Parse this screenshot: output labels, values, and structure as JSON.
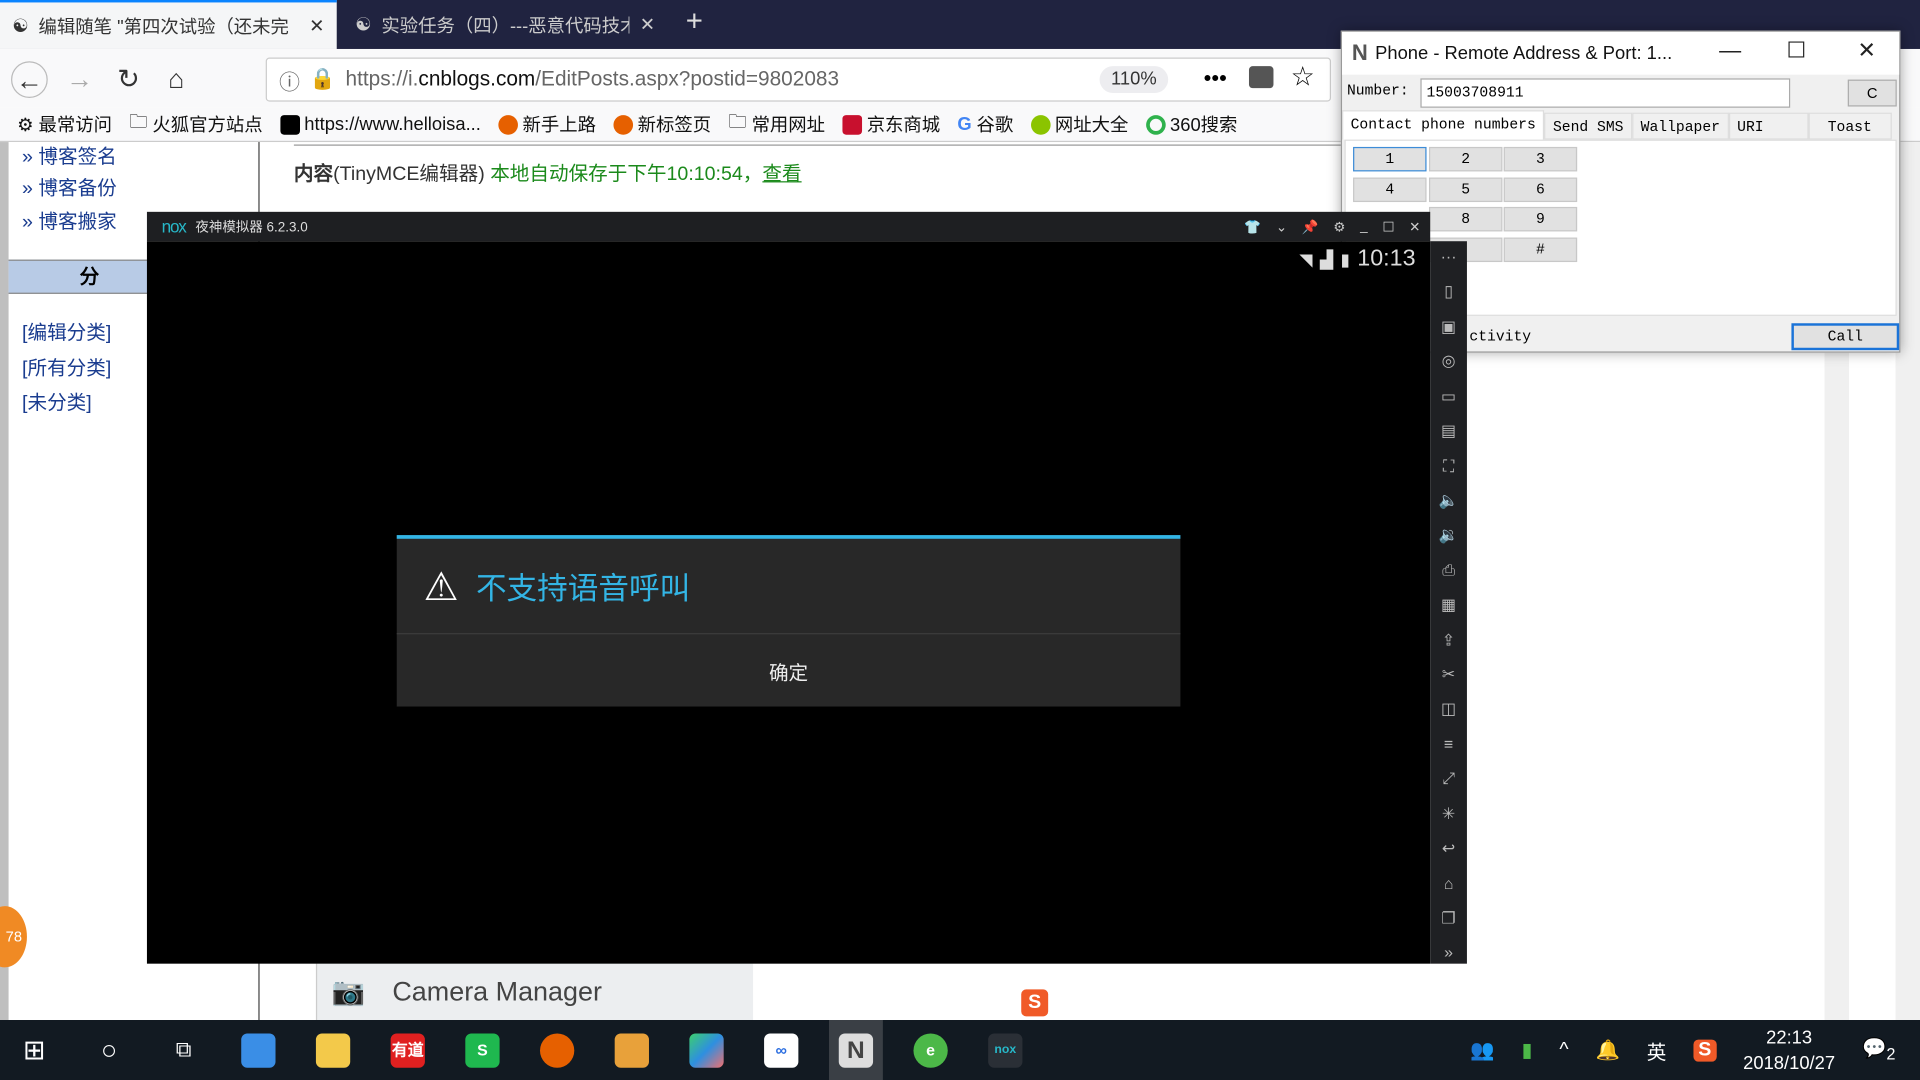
{
  "browser": {
    "tabs": [
      {
        "title": "编辑随笔 \"第四次试验（还未完",
        "active": true
      },
      {
        "title": "实验任务（四）---恶意代码技术",
        "active": false
      }
    ],
    "url_prefix": "https://i.",
    "url_domain": "cnblogs.com",
    "url_path": "/EditPosts.aspx?postid=9802083",
    "zoom": "110%",
    "bookmarks": [
      "最常访问",
      "火狐官方站点",
      "https://www.helloisa...",
      "新手上路",
      "新标签页",
      "常用网址",
      "京东商城",
      "谷歌",
      "网址大全",
      "360搜索"
    ]
  },
  "page": {
    "sidebar_links": [
      "» 博客签名",
      "» 博客备份",
      "» 博客搬家"
    ],
    "category_header": "分 类",
    "category_links": [
      "[编辑分类]",
      "[所有分类]",
      "[未分类]"
    ],
    "content_label": "内容",
    "content_editor": "(TinyMCE编辑器)",
    "autosave": "本地自动保存于下午10:10:54，",
    "view_link": "查看",
    "camera_manager": "Camera Manager",
    "badge": "78"
  },
  "nox": {
    "logo": "nox",
    "title": "夜神模拟器 6.2.3.0",
    "time": "10:13",
    "dialog": {
      "title": "不支持语音呼叫",
      "ok": "确定"
    }
  },
  "phone": {
    "title": "Phone - Remote Address & Port: 1...",
    "number_label": "Number:",
    "number": "15003708911",
    "clear": "C",
    "tabs": [
      "Contact phone numbers",
      "Send SMS",
      "Wallpaper",
      "URI",
      "Toast"
    ],
    "keys": [
      "1",
      "2",
      "3",
      "4",
      "5",
      "6",
      "",
      "8",
      "9",
      "",
      "#"
    ],
    "activity": "ctivity",
    "call": "Call"
  },
  "taskbar": {
    "time": "22:13",
    "date": "2018/10/27",
    "ime": "英",
    "notifications": "2"
  },
  "colors": {
    "accent": "#33b5e5",
    "tabbar": "#202340",
    "taskbar": "#121a22"
  }
}
